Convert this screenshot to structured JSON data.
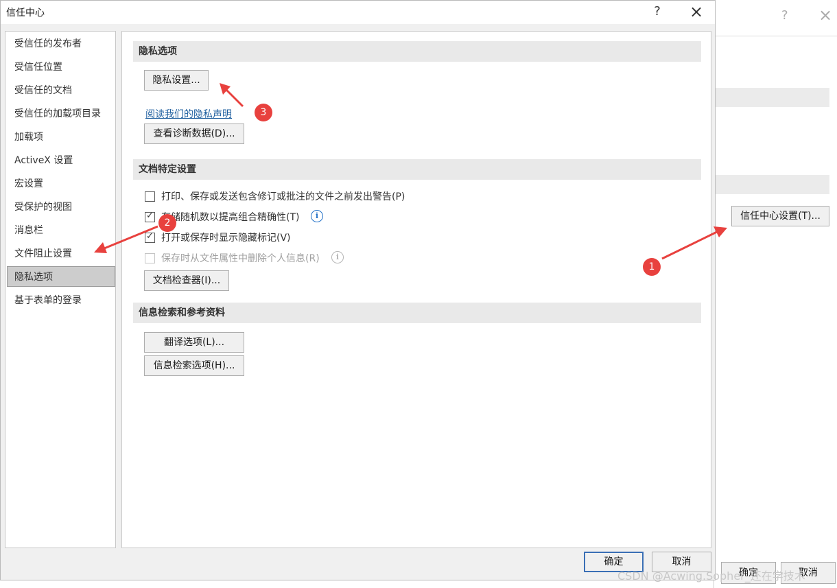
{
  "background_dialog": {
    "help_icon": "?",
    "close_icon": "×",
    "trust_center_settings_button": "信任中心设置(T)...",
    "ok_button": "确定",
    "cancel_button": "取消"
  },
  "dialog": {
    "title": "信任中心",
    "help_icon": "?",
    "close_icon": "×"
  },
  "nav": {
    "items": [
      {
        "label": "受信任的发布者"
      },
      {
        "label": "受信任位置"
      },
      {
        "label": "受信任的文档"
      },
      {
        "label": "受信任的加载项目录"
      },
      {
        "label": "加载项"
      },
      {
        "label": "ActiveX 设置"
      },
      {
        "label": "宏设置"
      },
      {
        "label": "受保护的视图"
      },
      {
        "label": "消息栏"
      },
      {
        "label": "文件阻止设置"
      },
      {
        "label": "隐私选项",
        "selected": true
      },
      {
        "label": "基于表单的登录"
      }
    ]
  },
  "privacy": {
    "header": "隐私选项",
    "settings_button": "隐私设置...",
    "statement_link": "阅读我们的隐私声明",
    "diagnostic_button": "查看诊断数据(D)..."
  },
  "document": {
    "header": "文档特定设置",
    "options": [
      {
        "label": "打印、保存或发送包含修订或批注的文件之前发出警告(P)",
        "checked": false,
        "enabled": true
      },
      {
        "label": "存储随机数以提高组合精确性(T)",
        "checked": true,
        "enabled": true
      },
      {
        "label": "打开或保存时显示隐藏标记(V)",
        "checked": true,
        "enabled": true
      },
      {
        "label": "保存时从文件属性中删除个人信息(R)",
        "checked": false,
        "enabled": false
      }
    ],
    "inspector_button": "文档检查器(I)..."
  },
  "research": {
    "header": "信息检索和参考资料",
    "translate_button": "翻译选项(L)...",
    "research_button": "信息检索选项(H)..."
  },
  "footer": {
    "ok_button": "确定",
    "cancel_button": "取消"
  },
  "annotations": {
    "badge_1": "1",
    "badge_2": "2",
    "badge_3": "3",
    "color": "#e8413e"
  },
  "watermark": "CSDN @Acwing.Sopher_还在学技术",
  "colors": {
    "link": "#1f5f9f",
    "info_icon": "#2472c8",
    "selected_nav": "#cdcdcd"
  }
}
